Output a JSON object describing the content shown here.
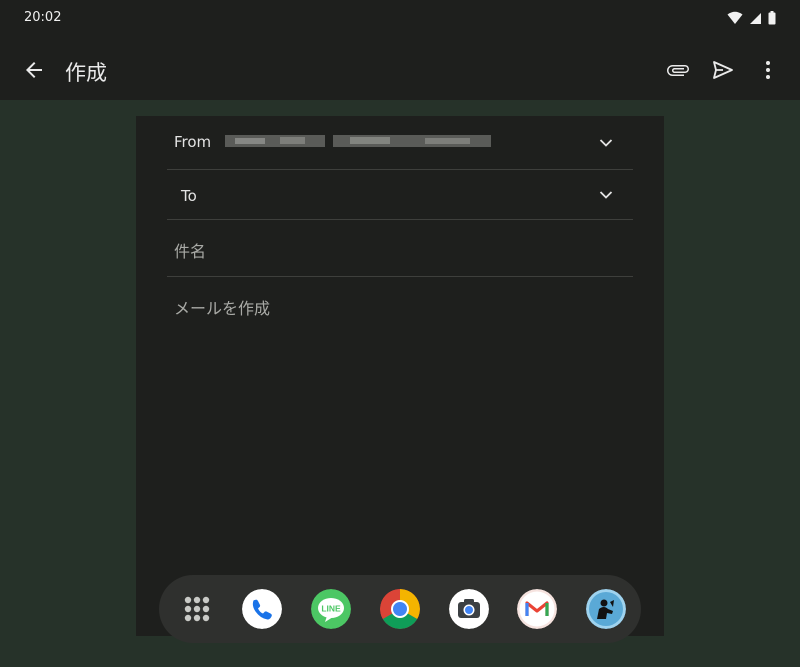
{
  "status": {
    "time": "20:02"
  },
  "appbar": {
    "title": "作成",
    "back_icon": "arrow-back-icon",
    "actions": [
      "attach-icon",
      "send-icon",
      "more-vert-icon"
    ]
  },
  "compose": {
    "from_label": "From",
    "to_label": "To",
    "subject_placeholder": "件名",
    "body_placeholder": "メールを作成"
  },
  "dock": {
    "apps": [
      "app-drawer-icon",
      "phone-icon",
      "line-icon",
      "chrome-icon",
      "camera-icon",
      "gmail-icon",
      "kindle-icon"
    ],
    "line_text": "LINE"
  },
  "colors": {
    "background": "#263229",
    "surface": "#1e1f1d",
    "divider": "#3e3f3c",
    "text": "#e6e6e6",
    "placeholder": "#a9aaa6"
  }
}
